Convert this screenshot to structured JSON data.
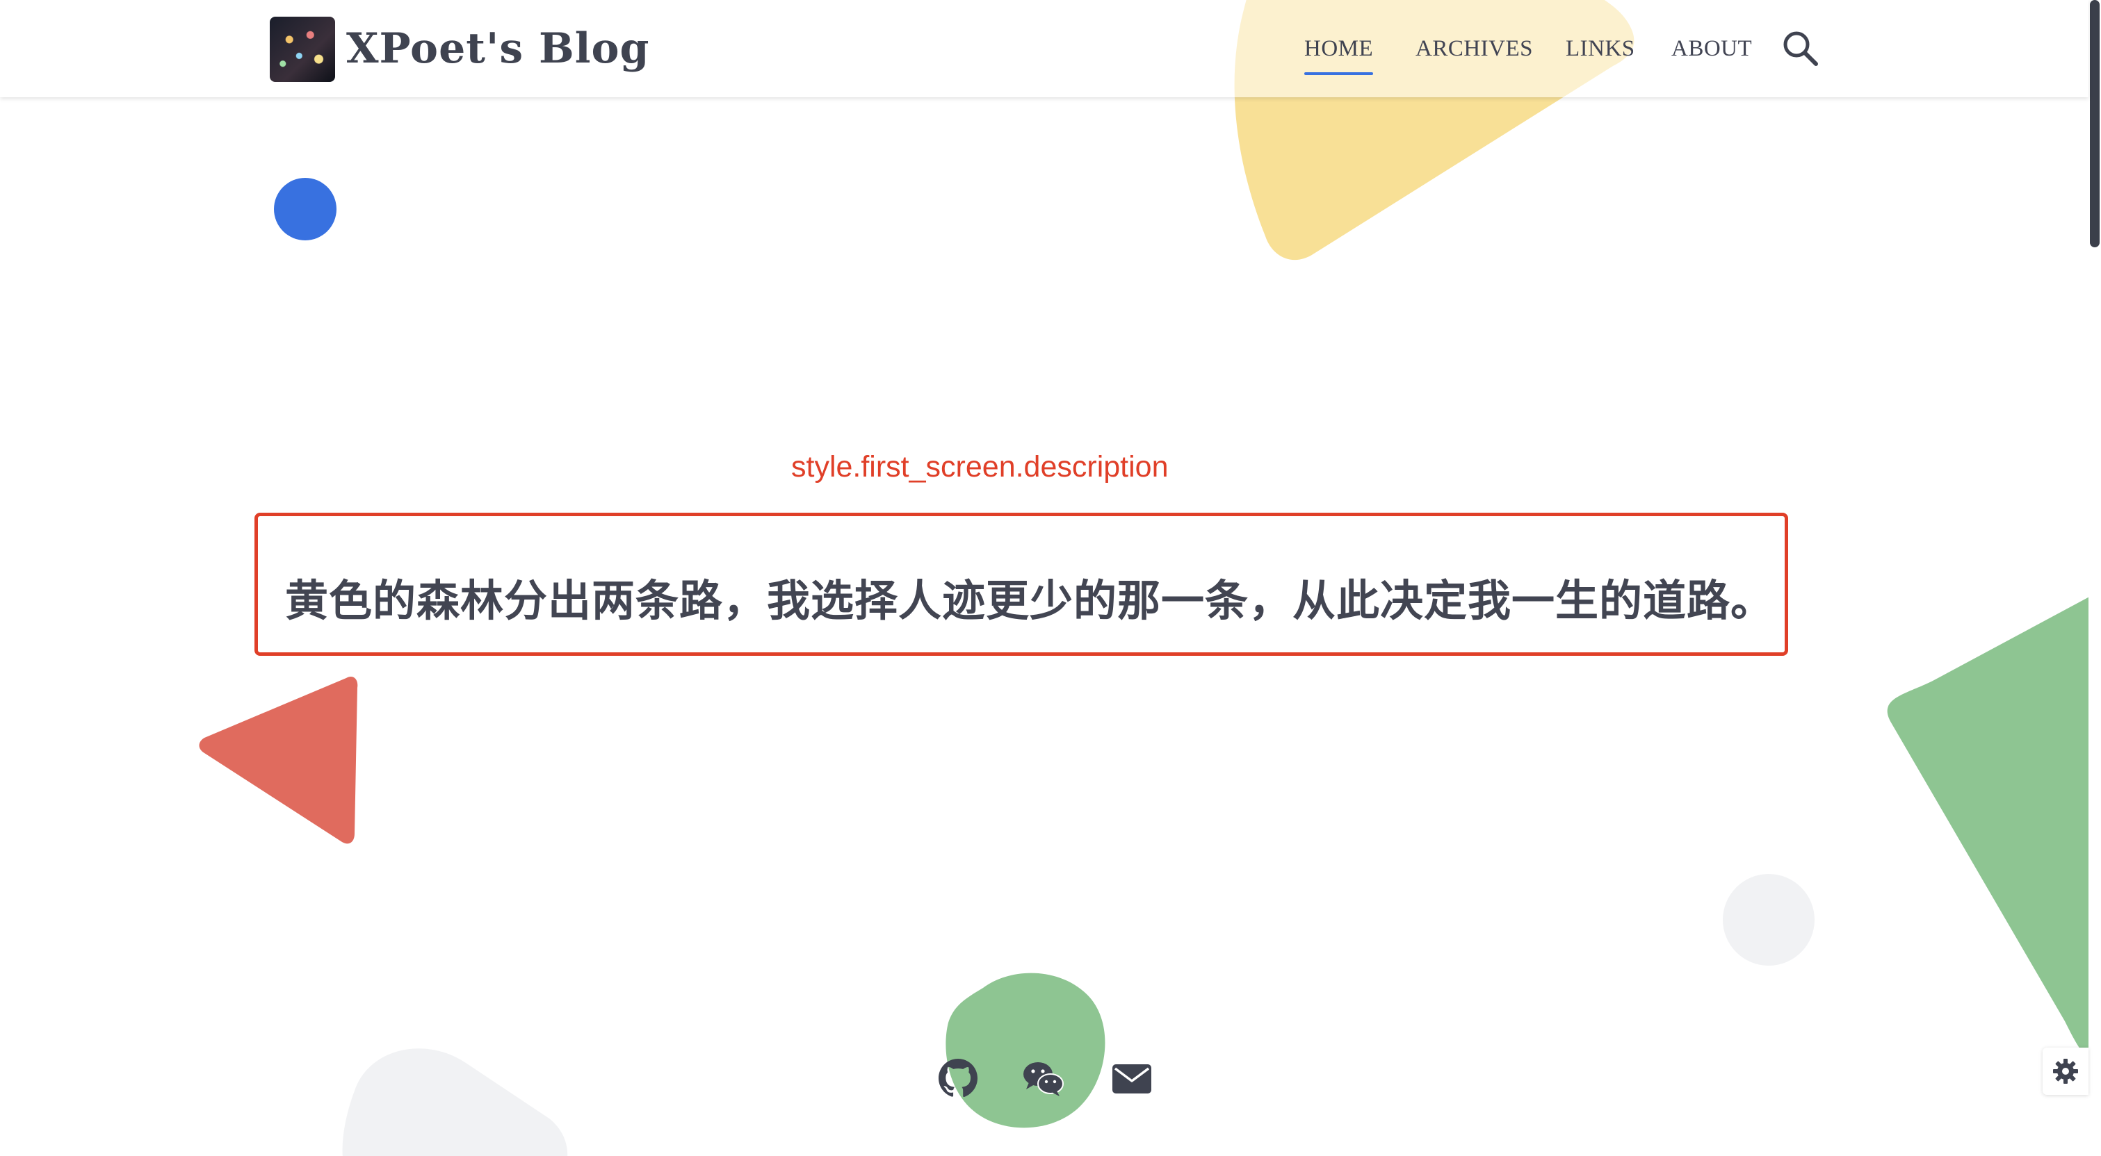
{
  "header": {
    "site_title": "XPoet's Blog",
    "nav": [
      {
        "label": "HOME",
        "active": true
      },
      {
        "label": "ARCHIVES",
        "active": false
      },
      {
        "label": "LINKS",
        "active": false
      },
      {
        "label": "ABOUT",
        "active": false
      }
    ],
    "search_icon": "search-icon"
  },
  "first_screen": {
    "description_label": "style.first_screen.description",
    "description": "黄色的森林分出两条路，我选择人迹更少的那一条，从此决定我一生的道路。"
  },
  "social": [
    {
      "icon": "github-icon"
    },
    {
      "icon": "wechat-icon"
    },
    {
      "icon": "mail-icon"
    }
  ],
  "settings": {
    "icon": "gear-icon"
  },
  "colors": {
    "accent": "#3871e0",
    "annotation_red": "#e03f28",
    "yellow": "#f5cf5e",
    "green": "#8ec592",
    "red_shape": "#e06b5e",
    "text": "#424552"
  }
}
